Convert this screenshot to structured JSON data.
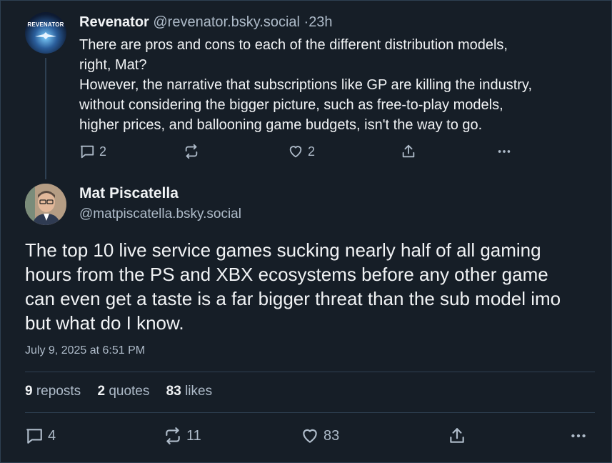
{
  "parent_post": {
    "avatar_text": "REVENATOR",
    "display_name": "Revenator",
    "handle": "@revenator.bsky.social",
    "separator": "·",
    "time": "23h",
    "text_lines": [
      "There are pros and cons to each of the different distribution models,",
      "right, Mat?",
      "However, the narrative that subscriptions like GP are killing the industry,",
      "without considering the bigger picture, such as free-to-play models,",
      "higher prices, and ballooning game budgets, isn't the way to go."
    ],
    "actions": {
      "reply_icon": "reply-icon",
      "reply_count": "2",
      "repost_icon": "repost-icon",
      "like_icon": "heart-icon",
      "like_count": "2",
      "share_icon": "share-icon",
      "more_icon": "more-icon"
    }
  },
  "main_post": {
    "display_name": "Mat Piscatella",
    "handle": "@matpiscatella.bsky.social",
    "text_lines": [
      "The top 10 live service games sucking nearly half of all gaming",
      "hours from the PS and XBX ecosystems before any other game",
      "can even get a taste is a far bigger threat than the sub model imo",
      "but what do I know."
    ],
    "timestamp": "July 9, 2025 at 6:51 PM",
    "stats": {
      "reposts_count": "9",
      "reposts_label": "reposts",
      "quotes_count": "2",
      "quotes_label": "quotes",
      "likes_count": "83",
      "likes_label": "likes"
    },
    "actions": {
      "reply_count": "4",
      "repost_count": "11",
      "like_count": "83"
    }
  },
  "colors": {
    "background": "#161e27",
    "text": "#f1f3f5",
    "muted": "#aebbc9",
    "border": "#2e4052"
  }
}
